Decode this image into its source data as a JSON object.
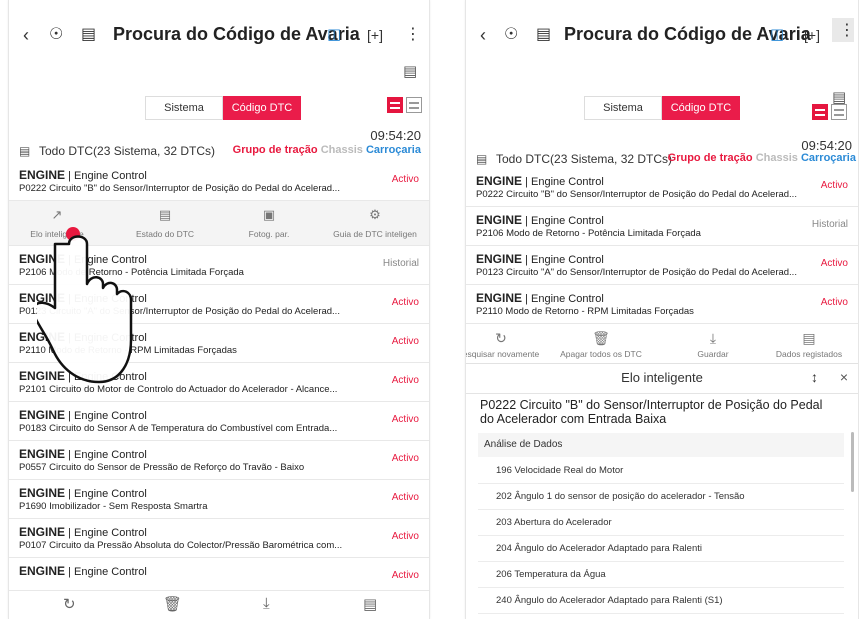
{
  "header": {
    "title": "Procura do Código de Avaria",
    "back_icon": "back-icon",
    "vci_icon": "vci-icon",
    "car_sync_icon": "car-sync-icon",
    "guide_icon": "guide-icon",
    "expand_icon": "expand-icon",
    "more_icon": "more-icon"
  },
  "tabs": {
    "system": "Sistema",
    "dtc": "Código DTC"
  },
  "summary": {
    "time": "09:54:20",
    "text": "Todo DTC(23 Sistema, 32 DTCs)",
    "filter_powertrain": "Grupo de tração",
    "filter_chassis": "Chassis",
    "filter_body": "Carroçaria"
  },
  "left_list": [
    {
      "sys": "ENGINE",
      "module": "Engine Control",
      "desc": "P0222 Circuito \"B\" do Sensor/Interruptor de Posição do Pedal do Acelerad...",
      "status": "Activo"
    },
    {
      "sys": "ENGINE",
      "module": "Engine Control",
      "desc": "P2106 Modo de Retorno - Potência Limitada Forçada",
      "status": "Historial"
    },
    {
      "sys": "ENGINE",
      "module": "Engine Control",
      "desc": "P0123 Circuito \"A\" do Sensor/Interruptor de Posição do Pedal do Acelerad...",
      "status": "Activo"
    },
    {
      "sys": "ENGINE",
      "module": "Engine Control",
      "desc": "P2110 Modo de Retorno - RPM Limitadas Forçadas",
      "status": "Activo"
    },
    {
      "sys": "ENGINE",
      "module": "Engine Control",
      "desc": "P2101 Circuito do Motor de Controlo do Actuador do Acelerador - Alcance...",
      "status": "Activo"
    },
    {
      "sys": "ENGINE",
      "module": "Engine Control",
      "desc": "P0183 Circuito do Sensor A de Temperatura do Combustível com Entrada...",
      "status": "Activo"
    },
    {
      "sys": "ENGINE",
      "module": "Engine Control",
      "desc": "P0557 Circuito do Sensor de Pressão de Reforço do Travão - Baixo",
      "status": "Activo"
    },
    {
      "sys": "ENGINE",
      "module": "Engine Control",
      "desc": "P1690 Imobilizador - Sem Resposta Smartra",
      "status": "Activo"
    },
    {
      "sys": "ENGINE",
      "module": "Engine Control",
      "desc": "P0107 Circuito da Pressão Absoluta do Colector/Pressão Barométrica com...",
      "status": "Activo"
    },
    {
      "sys": "ENGINE",
      "module": "Engine Control",
      "desc": "",
      "status": "Activo"
    }
  ],
  "item_actions": {
    "smart_link": "Elo inteligente",
    "dtc_status": "Estado do DTC",
    "freeze_frame": "Fotog. par.",
    "dtc_guide": "Guia de DTC inteligen"
  },
  "right_list": [
    {
      "sys": "ENGINE",
      "module": "Engine Control",
      "desc": "P0222 Circuito \"B\" do Sensor/Interruptor de Posição do Pedal do Acelerad...",
      "status": "Activo"
    },
    {
      "sys": "ENGINE",
      "module": "Engine Control",
      "desc": "P2106 Modo de Retorno - Potência Limitada Forçada",
      "status": "Historial"
    },
    {
      "sys": "ENGINE",
      "module": "Engine Control",
      "desc": "P0123 Circuito \"A\" do Sensor/Interruptor de Posição do Pedal do Acelerad...",
      "status": "Activo"
    },
    {
      "sys": "ENGINE",
      "module": "Engine Control",
      "desc": "P2110 Modo de Retorno - RPM Limitadas Forçadas",
      "status": "Activo"
    }
  ],
  "toolbar": {
    "rescan": "esquisar novamente",
    "clear_all": "Apagar todos os DTC",
    "save": "Guardar",
    "saved_data": "Dados registados"
  },
  "smart_link_panel": {
    "title": "Elo inteligente",
    "dtc_title": "P0222 Circuito \"B\" do Sensor/Interruptor de Posição do Pedal do Acelerador com Entrada Baixa",
    "section": "Análise de Dados",
    "items": [
      "196 Velocidade Real do Motor",
      "202 Ângulo 1 do sensor de posição do acelerador - Tensão",
      "203 Abertura do Acelerador",
      "204 Ângulo do Acelerador Adaptado para Ralenti",
      "206 Temperatura da Água",
      "240 Ângulo do Acelerador Adaptado para Ralenti (S1)"
    ]
  },
  "colors": {
    "accent": "#ea1c4a",
    "link_blue": "#2b8ad6"
  }
}
